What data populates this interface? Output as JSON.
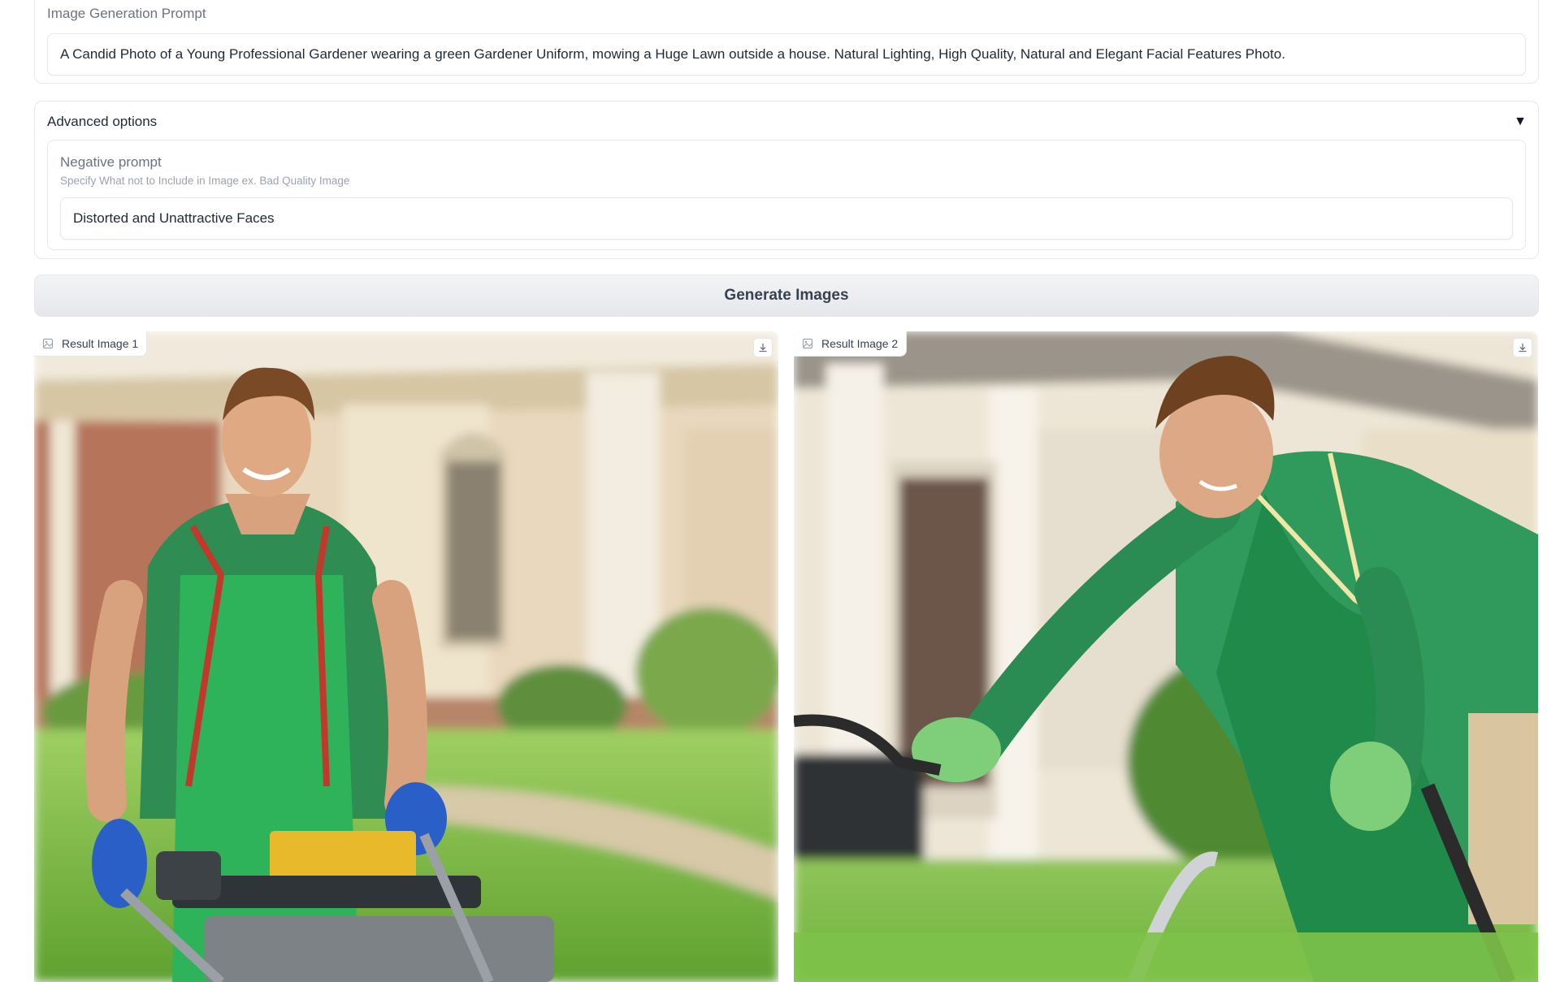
{
  "prompt": {
    "label": "Image Generation Prompt",
    "value": "A Candid Photo of a Young Professional Gardener wearing a green Gardener Uniform, mowing a Huge Lawn outside a house. Natural Lighting, High Quality, Natural and Elegant Facial Features Photo."
  },
  "advanced": {
    "title": "Advanced options",
    "chevron": "▼",
    "negative": {
      "label": "Negative prompt",
      "info": "Specify What not to Include in Image ex. Bad Quality Image",
      "value": "Distorted and Unattractive Faces"
    }
  },
  "generate": {
    "label": "Generate Images"
  },
  "results": [
    {
      "label": "Result Image 1",
      "icon": "image-icon",
      "download_icon": "download-icon"
    },
    {
      "label": "Result Image 2",
      "icon": "image-icon",
      "download_icon": "download-icon"
    }
  ],
  "colors": {
    "accent_green": "#2e9a5c",
    "lawn_green": "#7cc04a",
    "glove_blue": "#2a5fc8",
    "mower_yellow": "#e8b92a"
  }
}
